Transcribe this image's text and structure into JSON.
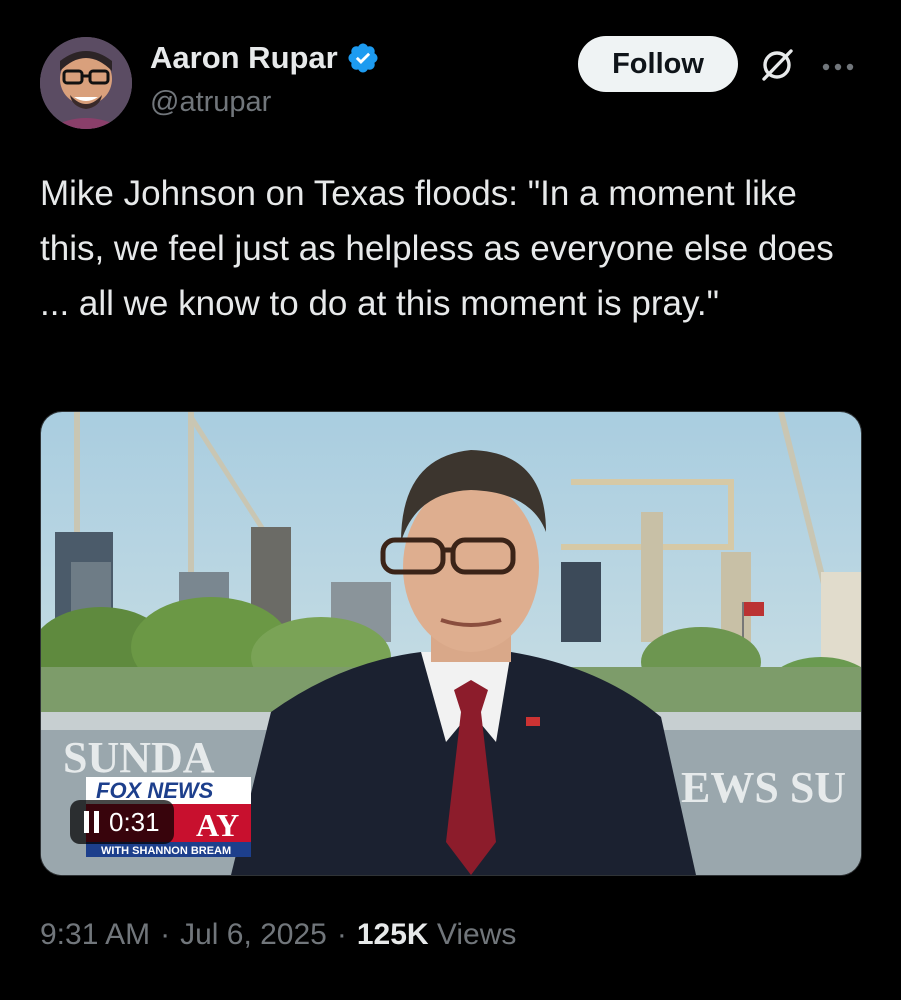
{
  "author": {
    "name": "Aaron Rupar",
    "handle": "@atrupar",
    "verified": true
  },
  "actions": {
    "follow_label": "Follow"
  },
  "tweet": {
    "text": "Mike Johnson on Texas floods: \"In a moment like this, we feel just as helpless as everyone else does ... all we know to do at this moment is pray.\""
  },
  "video": {
    "duration": "0:31",
    "state": "playing",
    "lower_third": {
      "network": "FOX NEWS",
      "show_partial": "SUNDA",
      "show_line2": "AY",
      "host_line": "WITH SHANNON BREAM"
    },
    "set_text_right": "EWS SU"
  },
  "meta": {
    "time": "9:31 AM",
    "date": "Jul 6, 2025",
    "views_count": "125K",
    "views_label": "Views",
    "separator": "·"
  },
  "colors": {
    "background": "#000000",
    "text": "#e7e9ea",
    "muted": "#71767b",
    "verified": "#1d9bf0",
    "follow_bg": "#eff3f4"
  },
  "icons": {
    "verified": "verified-badge-icon",
    "grok": "grok-icon",
    "more": "more-horizontal-icon",
    "pause": "pause-icon"
  }
}
